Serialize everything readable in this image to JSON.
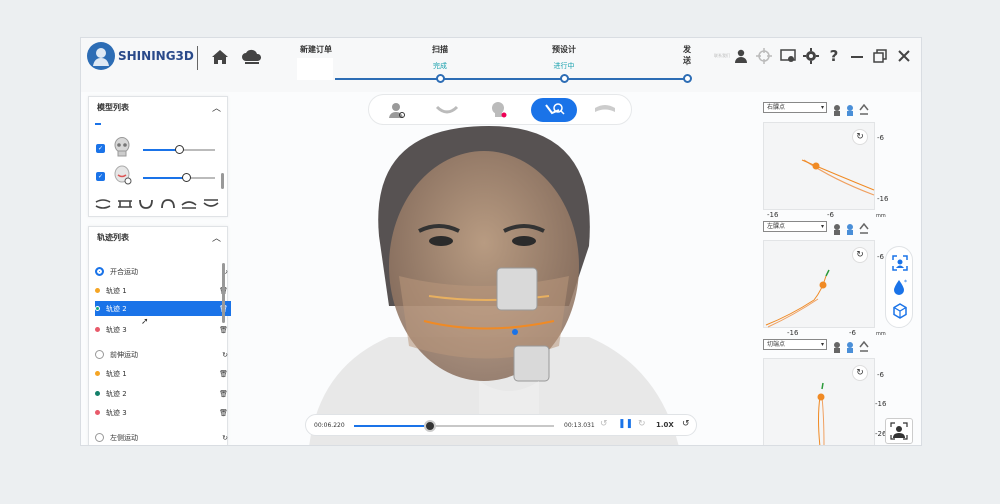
{
  "header": {
    "brand": "SHINING3D",
    "tiny_text": "联系我们",
    "steps": [
      {
        "title": "新建订单",
        "status": ""
      },
      {
        "title": "扫描",
        "status": "完成"
      },
      {
        "title": "预设计",
        "status": "进行中"
      },
      {
        "title": "发送",
        "status": "-"
      }
    ]
  },
  "model_panel": {
    "title": "模型列表",
    "items": [
      {
        "checked": true,
        "level": 0.5
      },
      {
        "checked": true,
        "level": 0.6
      }
    ]
  },
  "track_panel": {
    "title": "轨迹列表",
    "groups": [
      {
        "label": "开合运动",
        "selected": true,
        "tracks": [
          {
            "label": "轨迹 1",
            "color": "#f5a524"
          },
          {
            "label": "轨迹 2",
            "color": "#14a77f",
            "selected": true
          },
          {
            "label": "轨迹 3",
            "color": "#e85a6a"
          }
        ]
      },
      {
        "label": "前伸运动",
        "selected": false,
        "tracks": [
          {
            "label": "轨迹 1",
            "color": "#f5a524"
          },
          {
            "label": "轨迹 2",
            "color": "#14806a"
          },
          {
            "label": "轨迹 3",
            "color": "#e85a6a"
          }
        ]
      },
      {
        "label": "左侧运动",
        "selected": false,
        "tracks": []
      }
    ]
  },
  "player": {
    "current": "00:06.220",
    "total": "00:13.031",
    "speed": "1.0X",
    "progress": 0.38
  },
  "right_panel": {
    "charts": [
      {
        "select": "右髁点",
        "ticks": [
          "-6",
          "-16",
          "-6",
          "-16",
          "mm"
        ]
      },
      {
        "select": "左髁点",
        "ticks": [
          "-6",
          "-16",
          "-6",
          "mm"
        ]
      },
      {
        "select": "切端点",
        "ticks": [
          "-6",
          "-16",
          "-26"
        ]
      }
    ]
  },
  "colors": {
    "accent": "#1a73e8",
    "brand": "#2a4a8a",
    "teal": "#17a0ad",
    "trace": "#f08a24"
  }
}
